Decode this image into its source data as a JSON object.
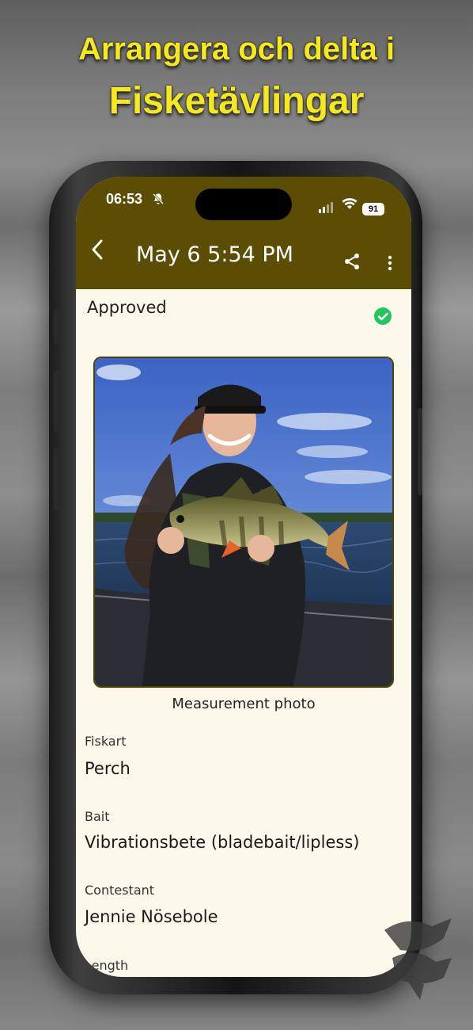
{
  "promo": {
    "line1": "Arrangera och delta i",
    "line2": "Fisketävlingar"
  },
  "status_bar": {
    "time": "06:53",
    "battery": "91"
  },
  "app_bar": {
    "title": "May 6 5:54 PM"
  },
  "catch": {
    "status": "Approved",
    "photo_caption": "Measurement photo",
    "fields": [
      {
        "label": "Fiskart",
        "value": "Perch"
      },
      {
        "label": "Bait",
        "value": "Vibrationsbete (bladebait/lipless)"
      },
      {
        "label": "Contestant",
        "value": "Jennie Nösebole"
      },
      {
        "label": "Length",
        "value": ""
      }
    ]
  },
  "icons": {
    "back": "chevron-left-icon",
    "share": "share-icon",
    "more": "more-vertical-icon",
    "status": "check-circle-icon",
    "mute": "bell-off-icon"
  },
  "colors": {
    "app_bar": "#5c4d05",
    "screen_bg": "#fcf8ea",
    "headline": "#f6e81e",
    "approved": "#22c55e"
  }
}
